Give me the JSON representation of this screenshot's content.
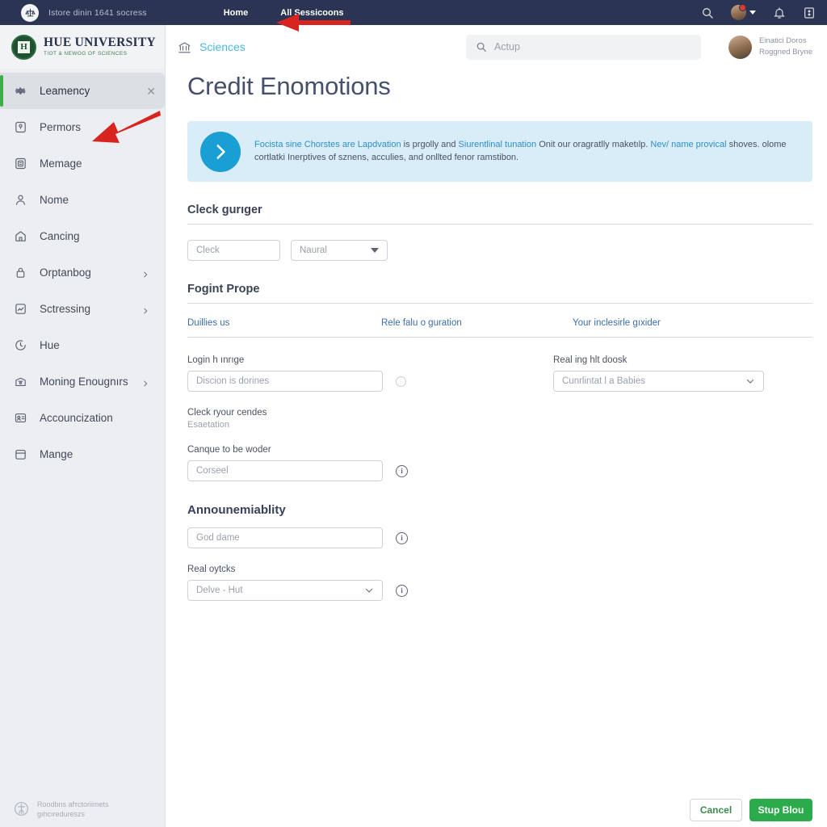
{
  "topbar": {
    "logo_icon": "scales-of-justice-icon",
    "brand": "Istore dinin 1641 socress",
    "links": [
      {
        "label": "Home"
      },
      {
        "label": "All Sessicoons"
      }
    ],
    "icons": {
      "search": "search-icon",
      "avatar": "avatar-icon",
      "caret": "chevron-down-icon",
      "notify": "bell-icon",
      "apps": "grid-icon"
    }
  },
  "sidebar": {
    "brand_name": "HUE UNIVERSITY",
    "brand_tagline": "TIOT & NEWOG OF SCIENCES",
    "brand_seal_letter": "H",
    "items": [
      {
        "label": "Leamency",
        "icon": "gear-icon",
        "active": true,
        "close": true,
        "chevron": false
      },
      {
        "label": "Permors",
        "icon": "badge-icon",
        "active": false,
        "close": false,
        "chevron": false
      },
      {
        "label": "Memage",
        "icon": "document-icon",
        "active": false,
        "close": false,
        "chevron": false
      },
      {
        "label": "Nome",
        "icon": "user-icon",
        "active": false,
        "close": false,
        "chevron": false
      },
      {
        "label": "Cancing",
        "icon": "bank-icon",
        "active": false,
        "close": false,
        "chevron": false
      },
      {
        "label": "Orptanbog",
        "icon": "lock-icon",
        "active": false,
        "close": false,
        "chevron": true
      },
      {
        "label": "Sctressing",
        "icon": "chart-icon",
        "active": false,
        "close": false,
        "chevron": true
      },
      {
        "label": "Hue",
        "icon": "clock-icon",
        "active": false,
        "close": false,
        "chevron": false
      },
      {
        "label": "Moning Enougnırs",
        "icon": "graduation-icon",
        "active": false,
        "close": false,
        "chevron": true
      },
      {
        "label": "Accounсization",
        "icon": "id-card-icon",
        "active": false,
        "close": false,
        "chevron": false
      },
      {
        "label": "Mange",
        "icon": "calendar-icon",
        "active": false,
        "close": false,
        "chevron": false
      }
    ],
    "footer": {
      "icon": "accessibility-icon",
      "line1": "Roodbns afтсtorіimets",
      "line2": "gıhcıredureszs"
    }
  },
  "header": {
    "breadcrumb_icon": "institution-icon",
    "breadcrumb": "Sciences",
    "search": {
      "icon": "search-icon",
      "placeholder": "Actup",
      "value": ""
    },
    "profile": {
      "avatar": "user-avatar",
      "line1": "Einatici Doros",
      "line2": "Roggned Bryne"
    }
  },
  "page": {
    "title": "Credit Enomotions"
  },
  "banner": {
    "icon": "chevron-right-circle-icon",
    "text_1": "Foсista sine Chorstes are Lapdvation",
    "text_2": " is prgolly and ",
    "text_3": "Siurentlinal tunation",
    "text_4": " Onit our oragratlly maketılp. ",
    "text_5": "Nev/ name provical",
    "text_6": " shoves. olome cortlatki Inerptives of sznens, acculies, and onllted fenor ramstibon."
  },
  "section_1": {
    "heading": "Cleck gurıger",
    "input_value": "Cleck",
    "select_value": "Naural"
  },
  "section_2": {
    "heading": "Fogint Prope",
    "columns": [
      {
        "label": "Duillies us"
      },
      {
        "label": "Rele falu o guration"
      },
      {
        "label": "Your inclesirle gıхider"
      }
    ]
  },
  "form": {
    "left": [
      {
        "label": "Login h ınrıge",
        "placeholder": "Discion is dorines",
        "type": "text",
        "adornment": "radio-empty-icon",
        "sub_label": "Cleck ryour cendes",
        "sub_text": "Esaetation"
      },
      {
        "label": "Canque to be woder",
        "placeholder": "Corseel",
        "type": "text",
        "adornment": "info-circle-icon",
        "sub_label": "",
        "sub_text": ""
      }
    ],
    "right": {
      "label": "Real ing hlt doosk",
      "value": "Cunrlintat l a Babies",
      "type": "select",
      "chevron": "chevron-down-icon"
    },
    "announce": {
      "heading": "Announemiablity",
      "placeholder": "God dame",
      "adornment": "info-circle-icon"
    },
    "last": {
      "label": "Real oytcks",
      "value": "Delve - Hut",
      "type": "select",
      "chevron": "chevron-down-icon",
      "adornment": "info-circle-icon"
    }
  },
  "actions": {
    "cancel_label": "Cancel",
    "save_label": "Stup Blou"
  },
  "colors": {
    "topbar_navy": "#2b3553",
    "accent_green": "#2cab4c",
    "active_bar_green": "#3fae49",
    "banner_blue": "#1a9fd4",
    "banner_bg": "#d9edf8",
    "link_blue": "#3c6ea8",
    "breadcrumb_cyan": "#4db8e0",
    "annotation_red": "#d8241f"
  }
}
